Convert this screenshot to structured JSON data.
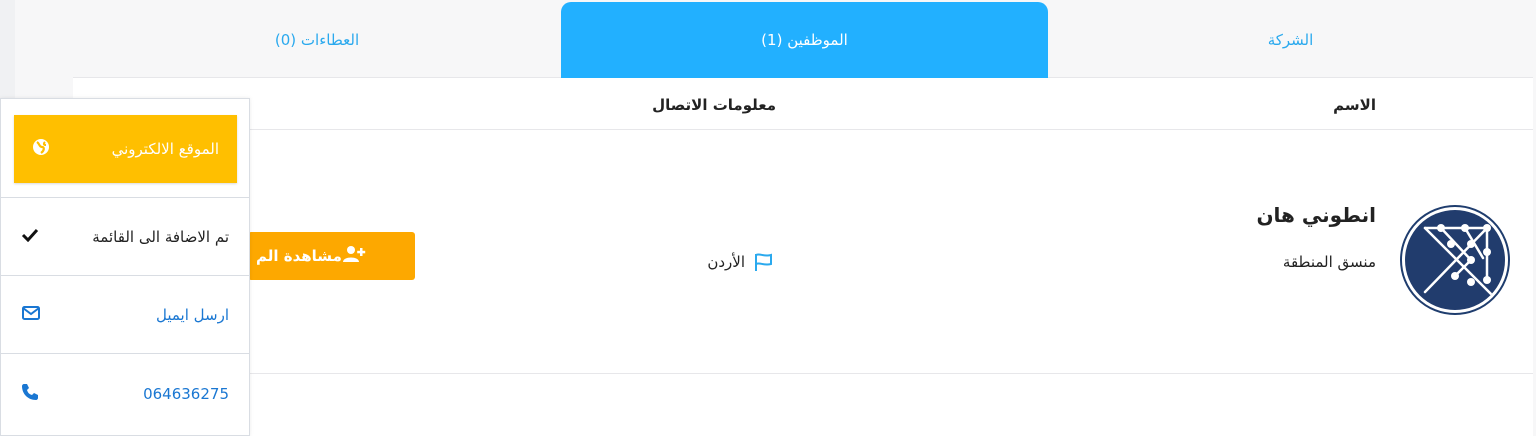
{
  "tabs": {
    "company": "الشركة",
    "employees": "الموظفين (1)",
    "offers": "العطاءات (0)"
  },
  "table": {
    "headers": {
      "name": "الاسم",
      "contact": "معلومات الاتصال"
    },
    "rows": [
      {
        "name": "انطوني هان",
        "role": "منسق المنطقة",
        "country": "الأردن",
        "button_label": "مشاهدة الم"
      }
    ]
  },
  "menu": {
    "website": "الموقع الالكتروني",
    "added": "تم الاضافة الى القائمة",
    "email": "ارسل ايميل",
    "phone": "064636275"
  },
  "colors": {
    "tab_active": "#22b0ff",
    "tab_text": "#2aa9ee",
    "website_button": "#ffbf00",
    "view_button": "#fda800",
    "link": "#1a77d2",
    "avatar_bg": "#213c6d"
  }
}
